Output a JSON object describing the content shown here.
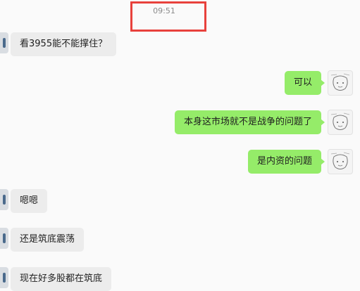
{
  "chat": {
    "timestamp": "09:51",
    "messages": [
      {
        "side": "in",
        "text": "看3955能不能撑住？"
      },
      {
        "side": "out",
        "text": "可以"
      },
      {
        "side": "out",
        "text": "本身这市场就不是战争的问题了"
      },
      {
        "side": "out",
        "text": "是内资的问题"
      },
      {
        "side": "in",
        "text": "嗯嗯"
      },
      {
        "side": "in",
        "text": "还是筑底震荡"
      },
      {
        "side": "in",
        "text": "现在好多股都在筑底"
      }
    ]
  },
  "colors": {
    "outgoing_bubble": "#95ec69",
    "incoming_bubble": "#ececec",
    "highlight_border": "#e8413c",
    "background": "#fafafa"
  }
}
